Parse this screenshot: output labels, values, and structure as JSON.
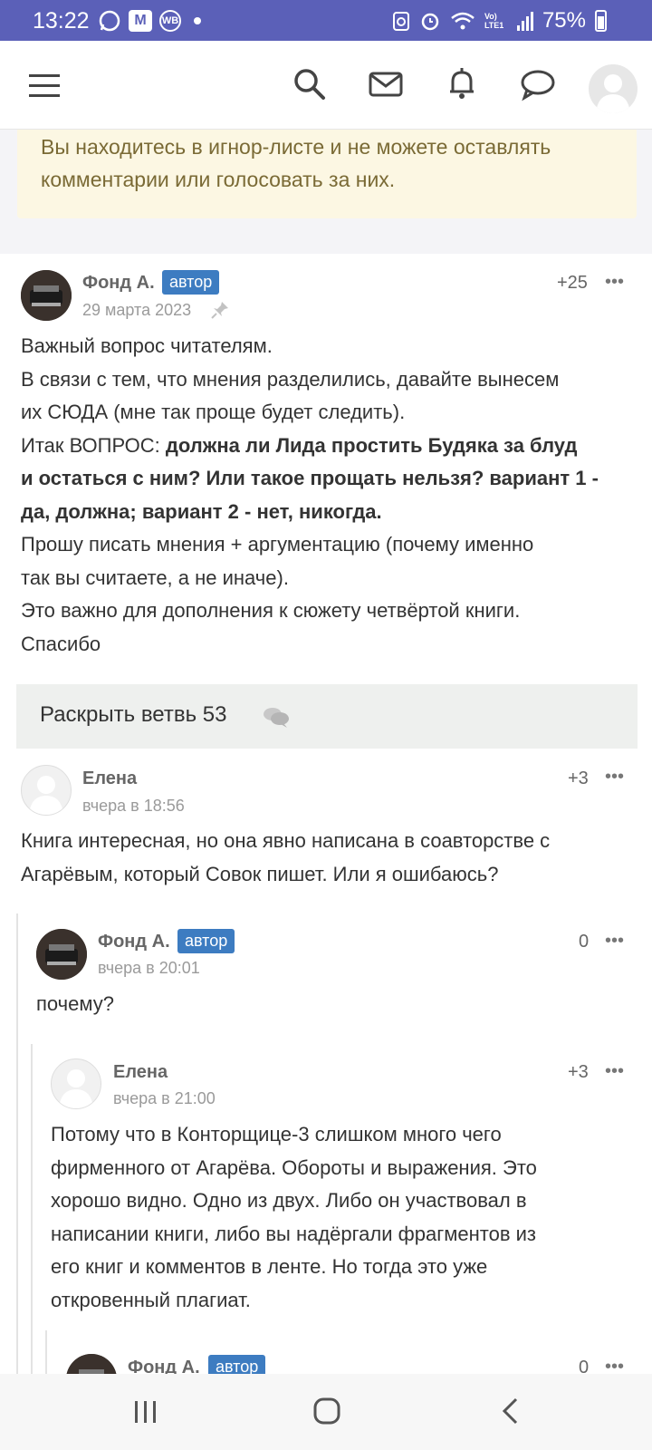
{
  "status_bar": {
    "time": "13:22",
    "battery": "75%",
    "wb_label": "WB",
    "lte_label": "Vo) LTE1"
  },
  "header": {
    "menu_icon": "hamburger-menu-icon",
    "search_icon": "search-icon",
    "mail_icon": "mail-icon",
    "bell_icon": "bell-icon",
    "chat_icon": "chat-bubble-icon"
  },
  "notice": {
    "text": "Вы находитесь в игнор-листе и не можете оставлять комментарии или голосовать за них."
  },
  "comments": [
    {
      "author": "Фонд А.",
      "badge": "автор",
      "date": "29 марта 2023",
      "score": "+25",
      "lines": [
        "Важный вопрос читателям.",
        "В связи с тем, что мнения разделились, давайте вынесем",
        "их СЮДА (мне так проще будет следить).",
        "Итак ВОПРОС: ",
        "должна ли Лида простить Будяка за блуд",
        "и остаться с ним? Или такое прощать нельзя? вариант 1 -",
        "да, должна; вариант 2 - нет, никогда.",
        "Прошу писать мнения + аргументацию (почему именно",
        "так вы считаете, а не иначе).",
        "Это важно для дополнения к сюжету четвёртой книги.",
        "Спасибо"
      ]
    },
    {
      "author": "Елена",
      "date": "вчера в 18:56",
      "score": "+3",
      "lines": [
        "Книга интересная, но она явно написана в соавторстве с",
        "Агарёвым, который Совок пишет. Или я ошибаюсь?"
      ]
    },
    {
      "author": "Фонд А.",
      "badge": "автор",
      "date": "вчера в 20:01",
      "score": "0",
      "lines": [
        "почему?"
      ]
    },
    {
      "author": "Елена",
      "date": "вчера в 21:00",
      "score": "+3",
      "lines": [
        "Потому что в Конторщице-3 слишком много чего",
        "фирменного от Агарёва. Обороты и выражения. Это",
        "хорошо видно. Одно из двух. Либо он участвовал в",
        "написании книги, либо вы надёргали фрагментов из",
        "его книг и комментов в ленте. Но тогда это уже",
        "откровенный плагиат."
      ]
    },
    {
      "author": "Фонд А.",
      "badge": "автор",
      "score": "0"
    }
  ],
  "more_label": "•••",
  "expand_branch": {
    "label": "Раскрыть ветвь 53"
  }
}
